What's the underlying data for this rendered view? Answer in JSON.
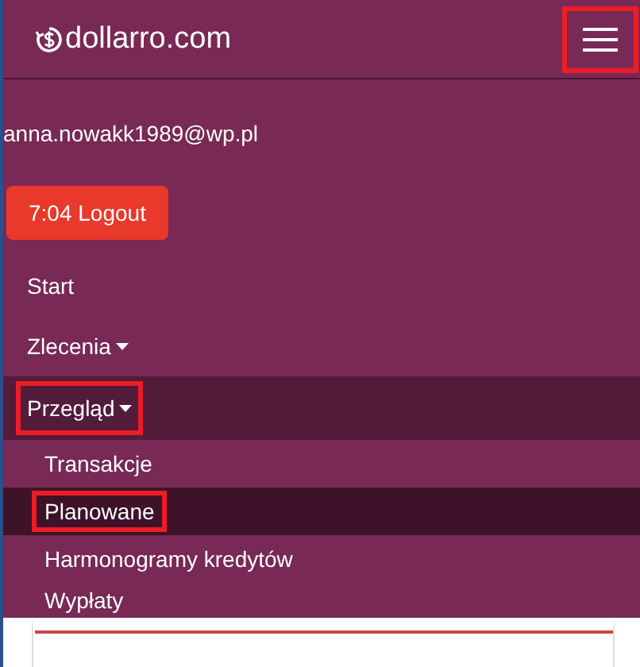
{
  "header": {
    "brand": "dollarro.com",
    "menu_highlighted": true
  },
  "user": {
    "email": "anna.nowakk1989@wp.pl"
  },
  "logout_button": "7:04 Logout",
  "nav": [
    {
      "label": "Start",
      "dropdown": false,
      "selected": false,
      "highlighted": false
    },
    {
      "label": "Zlecenia",
      "dropdown": true,
      "selected": false,
      "highlighted": false
    },
    {
      "label": "Przegląd",
      "dropdown": true,
      "selected": true,
      "highlighted": true,
      "children": [
        {
          "label": "Transakcje",
          "selected": false,
          "highlighted": false
        },
        {
          "label": "Planowane",
          "selected": true,
          "highlighted": true
        },
        {
          "label": "Harmonogramy kredytów",
          "selected": false,
          "highlighted": false
        },
        {
          "label": "Wypłaty",
          "selected": false,
          "highlighted": false
        }
      ]
    }
  ]
}
